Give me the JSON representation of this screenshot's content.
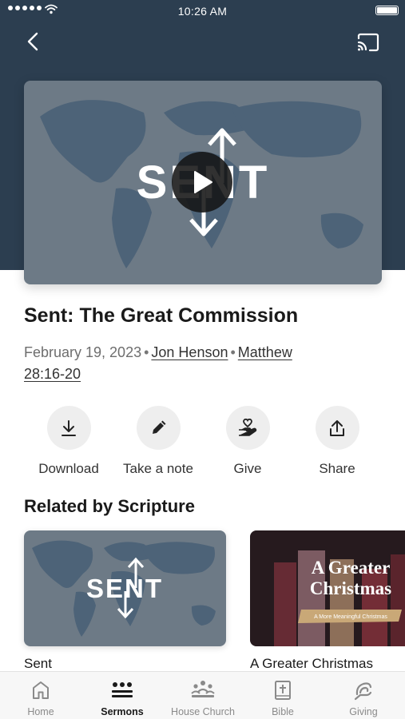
{
  "status_bar": {
    "time": "10:26 AM"
  },
  "hero": {
    "artwork_text": "SENT"
  },
  "sermon": {
    "title": "Sent: The Great Commission",
    "date": "February 19, 2023",
    "speaker": "Jon Henson",
    "scripture_line1": "Matthew",
    "scripture_line2": "28:16-20"
  },
  "actions": {
    "download": "Download",
    "note": "Take a note",
    "give": "Give",
    "share": "Share"
  },
  "related": {
    "title": "Related by Scripture",
    "items": [
      {
        "label": "Sent",
        "art_text": "SENT"
      },
      {
        "label": "A Greater Christmas",
        "art_title_1": "A Greater",
        "art_title_2": "Christmas",
        "art_subtitle": "A More Meaningful Christmas"
      }
    ]
  },
  "tabs": {
    "home": "Home",
    "sermons": "Sermons",
    "house_church": "House Church",
    "bible": "Bible",
    "giving": "Giving"
  },
  "colors": {
    "header_bg": "#2c3e50",
    "active_tab": "#1a1a1a",
    "inactive_tab": "#8a8a8a",
    "action_circle": "#eeeeee"
  }
}
